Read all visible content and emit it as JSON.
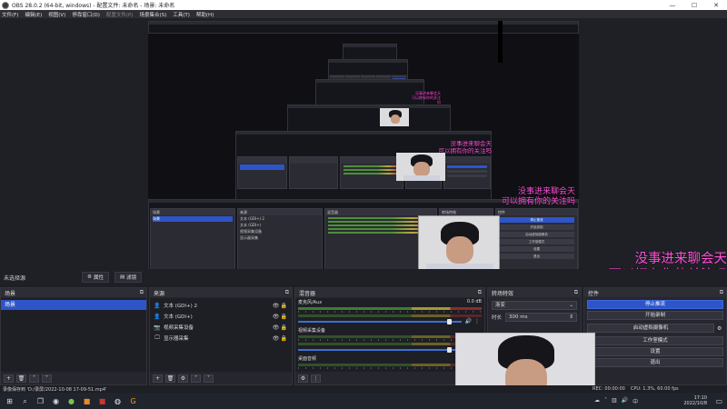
{
  "window": {
    "title": "OBS 28.0.2 (64-bit, windows) - 配置文件: 未命名 - 场景: 未命名",
    "controls": [
      "—",
      "☐",
      "✕"
    ]
  },
  "menu": [
    {
      "label": "文件(F)",
      "disabled": false
    },
    {
      "label": "编辑(E)",
      "disabled": false
    },
    {
      "label": "视图(V)",
      "disabled": false
    },
    {
      "label": "停靠窗口(D)",
      "disabled": false
    },
    {
      "label": "配置文件(P)",
      "disabled": true
    },
    {
      "label": "场景集合(S)",
      "disabled": false
    },
    {
      "label": "工具(T)",
      "disabled": false
    },
    {
      "label": "帮助(H)",
      "disabled": false
    }
  ],
  "overlay": {
    "line1": "没事进来聊会天",
    "line2": "可以拥有你的关注吗",
    "color": "#ff4fd8"
  },
  "toolbar": {
    "current_scene_label": "未选择源",
    "properties_label": "属性",
    "filters_label": "滤镜"
  },
  "docks": {
    "scenes": {
      "title": "场景",
      "items": [
        "场景"
      ]
    },
    "sources": {
      "title": "来源",
      "items": [
        {
          "icon": "user-icon",
          "glyph": "👤",
          "name": "文本 (GDI+) 2"
        },
        {
          "icon": "user-icon",
          "glyph": "👤",
          "name": "文本 (GDI+)"
        },
        {
          "icon": "camera-icon",
          "glyph": "📷",
          "name": "视频采集设备"
        },
        {
          "icon": "monitor-icon",
          "glyph": "🖵",
          "name": "显示器采集"
        }
      ]
    },
    "mixer": {
      "title": "混音器",
      "channels": [
        {
          "name": "麦克风/Aux",
          "db": "0.0 dB"
        },
        {
          "name": "视频采集设备",
          "db": ""
        },
        {
          "name": "桌面音频",
          "db": ""
        }
      ]
    },
    "transitions": {
      "title": "转场特效",
      "type": "渐变",
      "duration_label": "时长",
      "duration_value": "300 ms"
    },
    "controls": {
      "title": "控件",
      "buttons": [
        "停止推流",
        "开始录制",
        "启动虚拟摄像机",
        "工作室模式",
        "设置",
        "退出"
      ]
    }
  },
  "status": {
    "recording_saved": "录像保存到 'D:/录屏/2022-10-08 17-09-51.mp4'",
    "rec_time": "REC: 00:00:00",
    "cpu": "CPU: 1.3%, 60.00 fps"
  },
  "taskbar": {
    "time": "17:10",
    "date": "2022/10/8"
  },
  "mini": {
    "scene_label": "场景",
    "source_title": "来源",
    "mixer_title": "混音器",
    "trans_title": "转场特效",
    "ctrl_title": "控件",
    "stop_label": "停止推流",
    "record_label": "开始录制",
    "vcam_label": "启动虚拟摄像机",
    "studio_label": "工作室模式",
    "settings_label": "设置",
    "exit_label": "退出",
    "src1": "文本 (GDI+) 2",
    "src2": "文本 (GDI+)",
    "src3": "视频采集设备",
    "src4": "显示器采集",
    "overlay1": "没事进来聊会天",
    "overlay2": "可以拥有你的关注吗"
  }
}
